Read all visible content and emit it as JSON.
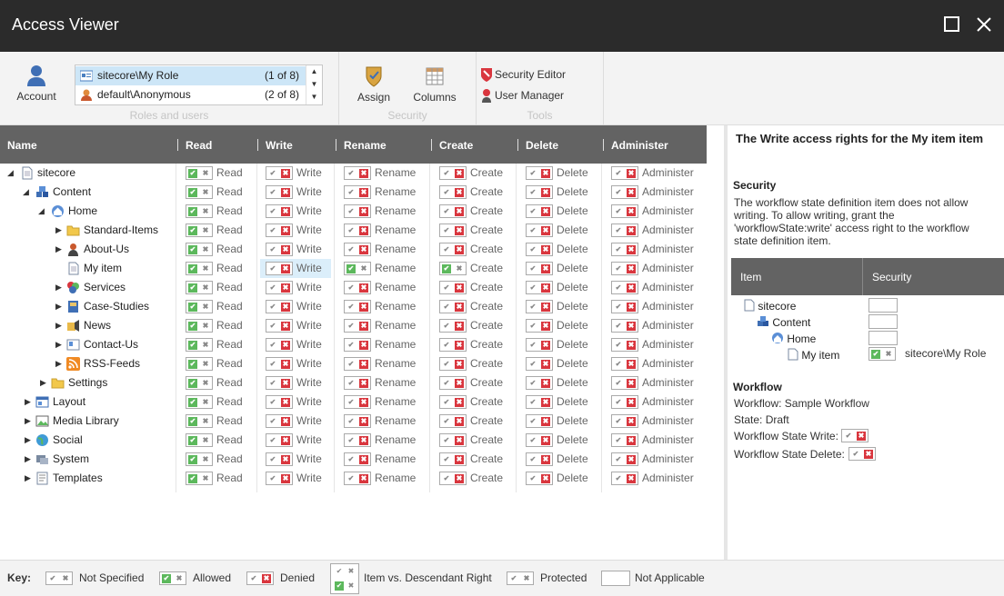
{
  "window": {
    "title": "Access Viewer"
  },
  "ribbon": {
    "account_label": "Account",
    "roles": [
      {
        "name": "sitecore\\My Role",
        "count": "(1 of 8)"
      },
      {
        "name": "default\\Anonymous",
        "count": "(2 of 8)"
      }
    ],
    "groups": {
      "roles": "Roles and users",
      "security": "Security",
      "tools": "Tools"
    },
    "assign_label": "Assign",
    "columns_label": "Columns",
    "security_editor_label": "Security Editor",
    "user_manager_label": "User Manager"
  },
  "grid": {
    "columns": [
      "Name",
      "Read",
      "Write",
      "Rename",
      "Create",
      "Delete",
      "Administer"
    ],
    "rows": [
      {
        "label": "sitecore",
        "level": 0,
        "arrow": "expanded",
        "icon": "document-icon"
      },
      {
        "label": "Content",
        "level": 1,
        "arrow": "expanded",
        "icon": "content-icon"
      },
      {
        "label": "Home",
        "level": 2,
        "arrow": "expanded",
        "icon": "home-icon"
      },
      {
        "label": "Standard-Items",
        "level": 3,
        "arrow": "collapsed",
        "icon": "folder-icon"
      },
      {
        "label": "About-Us",
        "level": 3,
        "arrow": "collapsed",
        "icon": "person-icon"
      },
      {
        "label": "My item",
        "level": 3,
        "arrow": "none",
        "icon": "document-icon",
        "selected": true
      },
      {
        "label": "Services",
        "level": 3,
        "arrow": "collapsed",
        "icon": "services-icon"
      },
      {
        "label": "Case-Studies",
        "level": 3,
        "arrow": "collapsed",
        "icon": "book-icon"
      },
      {
        "label": "News",
        "level": 3,
        "arrow": "collapsed",
        "icon": "news-icon"
      },
      {
        "label": "Contact-Us",
        "level": 3,
        "arrow": "collapsed",
        "icon": "contact-icon"
      },
      {
        "label": "RSS-Feeds",
        "level": 3,
        "arrow": "collapsed",
        "icon": "rss-icon"
      },
      {
        "label": "Settings",
        "level": 2,
        "arrow": "collapsed",
        "icon": "folder-icon"
      },
      {
        "label": "Layout",
        "level": 1,
        "arrow": "collapsed",
        "icon": "layout-icon"
      },
      {
        "label": "Media Library",
        "level": 1,
        "arrow": "collapsed",
        "icon": "media-icon"
      },
      {
        "label": "Social",
        "level": 1,
        "arrow": "collapsed",
        "icon": "globe-icon"
      },
      {
        "label": "System",
        "level": 1,
        "arrow": "collapsed",
        "icon": "system-icon"
      },
      {
        "label": "Templates",
        "level": 1,
        "arrow": "collapsed",
        "icon": "templates-icon"
      }
    ],
    "rights": {
      "read": "Read",
      "write": "Write",
      "rename": "Rename",
      "create": "Create",
      "delete": "Delete",
      "administer": "Administer"
    }
  },
  "details": {
    "title": "The Write access rights for the My item item",
    "security_heading": "Security",
    "security_text": "The workflow state definition item does not allow writing. To allow writing, grant the 'workflowState:write' access right to the workflow state definition item.",
    "table_headers": [
      "Item",
      "Security"
    ],
    "path": [
      "sitecore",
      "Content",
      "Home",
      "My item"
    ],
    "role_label": "sitecore\\My Role",
    "workflow_heading": "Workflow",
    "workflow": "Workflow: Sample Workflow",
    "state": "State: Draft",
    "state_write": "Workflow State Write:",
    "state_delete": "Workflow State Delete:"
  },
  "key": {
    "label": "Key:",
    "not_specified": "Not Specified",
    "allowed": "Allowed",
    "denied": "Denied",
    "item_vs_descendant": "Item vs. Descendant Right",
    "protected": "Protected",
    "not_applicable": "Not Applicable"
  },
  "colors": {
    "allowed": "#5cb85c",
    "denied": "#d9363e",
    "header": "#636363",
    "titlebar": "#2b2b2b",
    "selection": "#cde6f7"
  }
}
